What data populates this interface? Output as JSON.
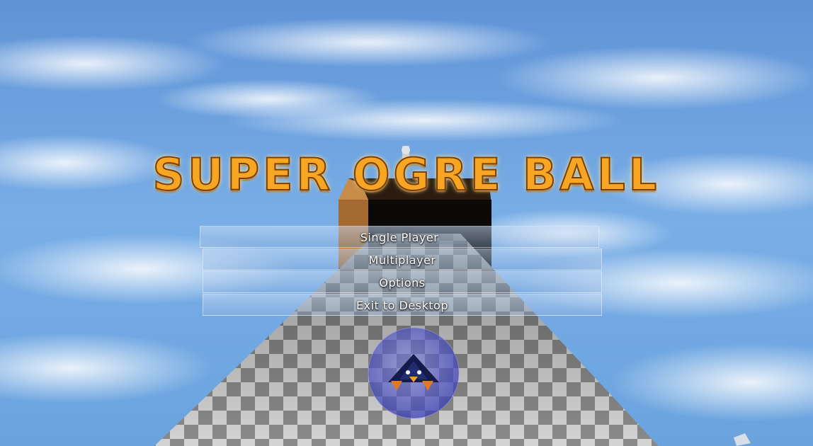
{
  "game": {
    "title": "SUPER OGRE BALL"
  },
  "menu": {
    "items": [
      {
        "label": "Single Player"
      },
      {
        "label": "Multiplayer"
      },
      {
        "label": "Options"
      },
      {
        "label": "Exit to Desktop"
      }
    ]
  },
  "colors": {
    "sky": "#6a9fdc",
    "title_fill": "#f6a623",
    "title_outline": "#7a3e06",
    "bubble": "#4a4fc8"
  }
}
